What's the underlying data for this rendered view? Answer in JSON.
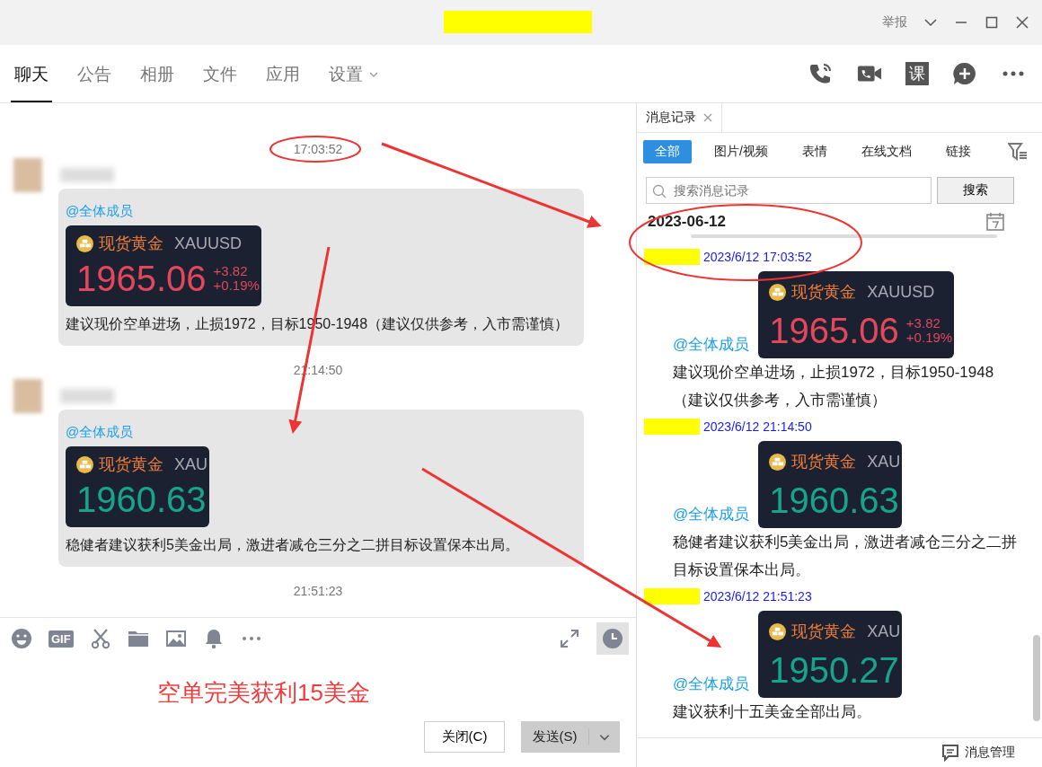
{
  "window": {
    "report_link": "举报"
  },
  "tabs": [
    {
      "label": "聊天",
      "selected": true,
      "has_menu": false
    },
    {
      "label": "公告",
      "selected": false,
      "has_menu": false
    },
    {
      "label": "相册",
      "selected": false,
      "has_menu": false
    },
    {
      "label": "文件",
      "selected": false,
      "has_menu": false
    },
    {
      "label": "应用",
      "selected": false,
      "has_menu": false
    },
    {
      "label": "设置",
      "selected": false,
      "has_menu": true
    }
  ],
  "header_actions": [
    {
      "kind": "call"
    },
    {
      "kind": "video"
    },
    {
      "kind": "course",
      "label": "课"
    },
    {
      "kind": "add"
    },
    {
      "kind": "more"
    }
  ],
  "chat": {
    "messages": [
      {
        "time": "17:03:52",
        "mention": "@全体成员",
        "card": {
          "name": "现货黄金",
          "code": "XAUUSD",
          "price": "1965.06",
          "rising": true,
          "change": "+3.82",
          "percent": "+0.19%"
        },
        "text": "建议现价空单进场，止损1972，目标1950-1948（建议仅供参考，入市需谨慎）"
      },
      {
        "time": "21:14:50",
        "mention": "@全体成员",
        "card": {
          "name": "现货黄金",
          "code": "XAU",
          "price": "1960.63",
          "rising": false
        },
        "text": "稳健者建议获利5美金出局，激进者减仓三分之二拼目标设置保本出局。"
      }
    ],
    "last_time": "21:51:23"
  },
  "composer": {
    "toolbar": [
      {
        "kind": "emoji"
      },
      {
        "kind": "gif",
        "label": "GIF"
      },
      {
        "kind": "scissors"
      },
      {
        "kind": "folder"
      },
      {
        "kind": "image"
      },
      {
        "kind": "bell"
      },
      {
        "kind": "more"
      }
    ],
    "caption": "空单完美获利15美金",
    "close_button": "关闭(C)",
    "send_button": "发送(S)"
  },
  "history": {
    "tab": "消息记录",
    "filters": [
      {
        "label": "全部",
        "selected": true
      },
      {
        "label": "图片/视频",
        "selected": false
      },
      {
        "label": "表情",
        "selected": false
      },
      {
        "label": "在线文档",
        "selected": false
      },
      {
        "label": "链接",
        "selected": false
      }
    ],
    "search": {
      "placeholder": "搜索消息记录",
      "button": "搜索"
    },
    "date": "2023-06-12",
    "entries": [
      {
        "time": "2023/6/12 17:03:52",
        "mention": "@全体成员",
        "card": {
          "name": "现货黄金",
          "code": "XAUUSD",
          "price": "1965.06",
          "rising": true,
          "change": "+3.82",
          "percent": "+0.19%"
        },
        "text": "建议现价空单进场，止损1972，目标1950-1948（建议仅供参考，入市需谨慎）"
      },
      {
        "time": "2023/6/12 21:14:50",
        "mention": "@全体成员",
        "card": {
          "name": "现货黄金",
          "code": "XAU",
          "price": "1960.63",
          "rising": false
        },
        "text": "稳健者建议获利5美金出局，激进者减仓三分之二拼目标设置保本出局。"
      },
      {
        "time": "2023/6/12 21:51:23",
        "mention": "@全体成员",
        "card": {
          "name": "现货黄金",
          "code": "XAU",
          "price": "1950.27",
          "rising": false
        },
        "text": "建议获利十五美金全部出局。"
      }
    ],
    "footer": "消息管理"
  }
}
